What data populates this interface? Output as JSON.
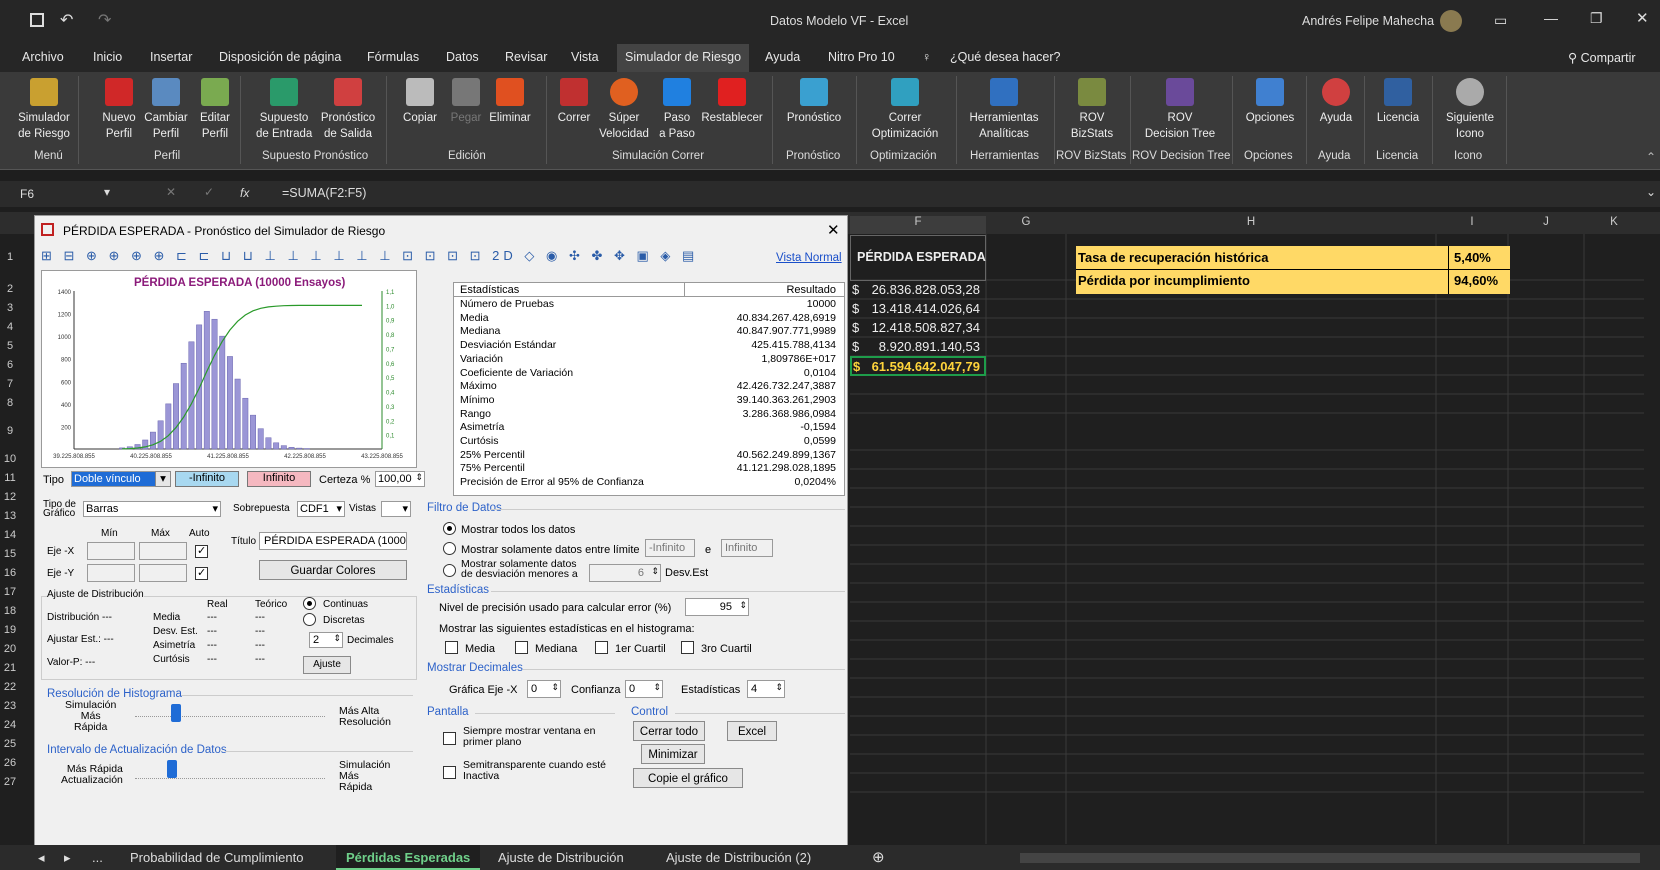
{
  "window": {
    "title": "Datos Modelo VF - Excel",
    "user": "Andrés Felipe Mahecha"
  },
  "ribbon_tabs": [
    "Archivo",
    "Inicio",
    "Insertar",
    "Disposición de página",
    "Fórmulas",
    "Datos",
    "Revisar",
    "Vista",
    "Simulador de Riesgo",
    "Ayuda",
    "Nitro Pro 10"
  ],
  "tell_me": "¿Qué desea hacer?",
  "share": "Compartir",
  "ribbon": {
    "buttons": [
      "Simulador\nde Riesgo",
      "Nuevo\nPerfil",
      "Cambiar\nPerfil",
      "Editar\nPerfil",
      "Supuesto\nde Entrada",
      "Pronóstico\nde Salida",
      "Copiar",
      "Pegar",
      "Eliminar",
      "Correr",
      "Súper\nVelocidad",
      "Paso\na Paso",
      "Restablecer",
      "Pronóstico",
      "Correr\nOptimización",
      "Herramientas\nAnalíticas",
      "ROV\nBizStats",
      "ROV\nDecision Tree",
      "Opciones",
      "Ayuda",
      "Licencia",
      "Siguiente\nIcono"
    ],
    "groups": [
      "Menú",
      "Perfil",
      "Supuesto Pronóstico",
      "Edición",
      "Simulación Correr",
      "Pronóstico",
      "Optimización",
      "Herramientas",
      "ROV BizStats",
      "ROV Decision Tree",
      "Opciones",
      "Ayuda",
      "Licencia",
      "Icono"
    ]
  },
  "formula_bar": {
    "cell_ref": "F6",
    "fx": "fx",
    "formula": "=SUMA(F2:F5)"
  },
  "columns": [
    "F",
    "G",
    "H",
    "I",
    "J",
    "K"
  ],
  "rows": [
    "1",
    "2",
    "3",
    "4",
    "5",
    "6",
    "7",
    "8",
    "9",
    "10",
    "11",
    "12",
    "13",
    "14",
    "15",
    "16",
    "17",
    "18",
    "19",
    "20",
    "21",
    "22",
    "23",
    "24",
    "25",
    "26",
    "27"
  ],
  "cells": {
    "f1": "PÉRDIDA ESPERADA",
    "h1": "Tasa de recuperación histórica",
    "i1": "5,40%",
    "h2": "Pérdida por incumplimiento",
    "i2": "94,60%",
    "f_vals": [
      "26.836.828.053,28",
      "13.418.414.026,64",
      "12.418.508.827,34",
      "8.920.891.140,53",
      "61.594.642.047,79"
    ],
    "currency": "$"
  },
  "dialog": {
    "title": "PÉRDIDA ESPERADA - Pronóstico del Simulador de Riesgo",
    "view_link": "Vista Normal",
    "chart_title": "PÉRDIDA ESPERADA (10000 Ensayos)",
    "stats_header": [
      "Estadísticas",
      "Resultado"
    ],
    "stats": [
      [
        "Número de Pruebas",
        "10000"
      ],
      [
        "Media",
        "40.834.267.428,6919"
      ],
      [
        "Mediana",
        "40.847.907.771,9989"
      ],
      [
        "Desviación Estándar",
        "425.415.788,4134"
      ],
      [
        "Variación",
        "1,809786E+017"
      ],
      [
        "Coeficiente de Variación",
        "0,0104"
      ],
      [
        "Máximo",
        "42.426.732.247,3887"
      ],
      [
        "Mínimo",
        "39.140.363.261,2903"
      ],
      [
        "Rango",
        "3.286.368.986,0984"
      ],
      [
        "Asimetría",
        "-0,1594"
      ],
      [
        "Curtósis",
        "0,0599"
      ],
      [
        "25% Percentil",
        "40.562.249.899,1367"
      ],
      [
        "75% Percentil",
        "41.121.298.028,1895"
      ],
      [
        "Precisión de Error al 95% de Confianza",
        "0,0204%"
      ]
    ],
    "tipo_label": "Tipo",
    "tipo_value": "Doble vínculo",
    "neg_inf": "-Infinito",
    "pos_inf": "Infinito",
    "certeza_label": "Certeza %",
    "certeza_value": "100,00",
    "tipo_grafico_label": "Tipo de\nGráfico",
    "tipo_grafico_value": "Barras",
    "sobrepuesta_label": "Sobrepuesta",
    "sobrepuesta_value": "CDF1",
    "vistas_label": "Vistas",
    "min": "Mín",
    "max": "Máx",
    "auto": "Auto",
    "eje_x": "Eje -X",
    "eje_y": "Eje -Y",
    "titulo_label": "Título",
    "titulo_value": "PÉRDIDA ESPERADA (1000",
    "guardar_colores": "Guardar Colores",
    "ajuste_dist": "Ajuste de Distribución",
    "real": "Real",
    "teorico": "Teórico",
    "distribucion": "Distribución ---",
    "ajustar_est": "Ajustar Est.: ---",
    "valor_p": "Valor-P: ---",
    "media": "Media",
    "desv_est": "Desv. Est.",
    "asimetria": "Asimetría",
    "curtosis": "Curtósis",
    "dash": "---",
    "continuas": "Continuas",
    "discretas": "Discretas",
    "decimales_value": "2",
    "decimales": "Decimales",
    "ajuste": "Ajuste",
    "resolucion": "Resolución de Histograma",
    "sim_mas_rapida": "Simulación\nMás\nRápida",
    "mas_alta_res": "Más Alta\nResolución",
    "intervalo": "Intervalo de Actualización de Datos",
    "mas_rapida_act": "Más Rápida\nActualización",
    "sim_mas_rapida2": "Simulación\nMás\nRápida",
    "filtro": "Filtro de Datos",
    "mostrar_todos": "Mostrar todos los datos",
    "mostrar_limite": "Mostrar solamente datos entre límite",
    "lim_a": "-Infinito",
    "y": "e",
    "lim_b": "Infinito",
    "mostrar_desv": "Mostrar solamente datos\nde desviación menores a",
    "desv_value": "6",
    "desv_est_lbl": "Desv.Est",
    "estadisticas": "Estadísticas",
    "nivel_precision": "Nivel de precisión usado para calcular error (%)",
    "nivel_value": "95",
    "mostrar_sig": "Mostrar las siguientes estadísticas en el histograma:",
    "chk_media": "Media",
    "chk_mediana": "Mediana",
    "chk_1er": "1er Cuartil",
    "chk_3ro": "3ro Cuartil",
    "mostrar_dec": "Mostrar Decimales",
    "grafica_eje": "Gráfica Eje -X",
    "ge_value": "0",
    "confianza": "Confianza",
    "conf_value": "0",
    "estad": "Estadísticas",
    "estad_value": "4",
    "pantalla": "Pantalla",
    "control": "Control",
    "siempre": "Siempre mostrar ventana en\nprimer plano",
    "semi": "Semitransparente cuando esté\nInactiva",
    "cerrar_todo": "Cerrar todo",
    "excel": "Excel",
    "minimizar": "Minimizar",
    "copie": "Copie el gráfico",
    "x_ticks": [
      "39.225.808.855",
      "40.225.808.855",
      "41.225.808.855",
      "42.225.808.855",
      "43.225.808.855"
    ],
    "y_ticks": [
      "1400",
      "1200",
      "1000",
      "800",
      "600",
      "400",
      "200"
    ],
    "y2_ticks": [
      "1,1",
      "1,0",
      "0,9",
      "0,8",
      "0,7",
      "0,6",
      "0,5",
      "0,4",
      "0,3",
      "0,2",
      "0,1"
    ]
  },
  "chart_data": {
    "type": "bar",
    "title": "PÉRDIDA ESPERADA (10000 Ensayos)",
    "x": [
      39.85,
      39.95,
      40.05,
      40.15,
      40.25,
      40.35,
      40.45,
      40.55,
      40.65,
      40.75,
      40.85,
      40.95,
      41.05,
      41.15,
      41.25,
      41.35,
      41.45,
      41.55,
      41.65,
      41.75,
      41.85,
      41.95,
      42.05,
      42.15,
      42.25
    ],
    "values": [
      10,
      20,
      40,
      80,
      150,
      250,
      400,
      580,
      760,
      950,
      1100,
      1220,
      1150,
      1000,
      820,
      620,
      450,
      300,
      180,
      100,
      55,
      30,
      15,
      8,
      4
    ],
    "ylim": [
      0,
      1400
    ],
    "series2": {
      "name": "CDF",
      "ylim": [
        0,
        1.1
      ]
    }
  },
  "sheet_tabs": [
    "...",
    "Probabilidad de Cumplimiento",
    "Pérdidas Esperadas",
    "Ajuste de Distribución",
    "Ajuste de Distribución (2)"
  ]
}
